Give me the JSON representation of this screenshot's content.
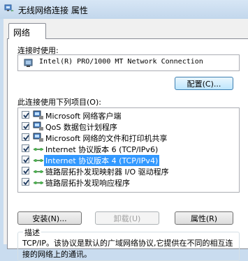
{
  "window": {
    "title": "无线网络连接 属性"
  },
  "tabs": [
    {
      "label": "网络"
    }
  ],
  "connect_using": {
    "label": "连接时使用:",
    "adapter": "Intel(R) PRO/1000 MT Network Connection",
    "configure_label": "配置(C)..."
  },
  "items": {
    "label": "此连接使用下列项目(O):",
    "list": [
      {
        "label": "Microsoft 网络客户端",
        "checked": true,
        "icon": "network-client-icon"
      },
      {
        "label": "QoS 数据包计划程序",
        "checked": true,
        "icon": "qos-icon"
      },
      {
        "label": "Microsoft 网络的文件和打印机共享",
        "checked": true,
        "icon": "file-printer-sharing-icon"
      },
      {
        "label": "Internet 协议版本 6 (TCP/IPv6)",
        "checked": true,
        "icon": "protocol-icon"
      },
      {
        "label": "Internet 协议版本 4 (TCP/IPv4)",
        "checked": true,
        "icon": "protocol-icon",
        "selected": true
      },
      {
        "label": "链路层拓扑发现映射器 I/O 驱动程序",
        "checked": true,
        "icon": "protocol-icon"
      },
      {
        "label": "链路层拓扑发现响应程序",
        "checked": true,
        "icon": "protocol-icon"
      }
    ]
  },
  "buttons": {
    "install": "安装(N)...",
    "uninstall": "卸载(U)",
    "properties": "属性(R)"
  },
  "description": {
    "legend": "描述",
    "text": "TCP/IP。该协议是默认的广域网络协议,它提供在不同的相互连接的网络上的通讯。"
  },
  "colors": {
    "selection": "#3399ff",
    "titlebar": "#c9dcef"
  }
}
